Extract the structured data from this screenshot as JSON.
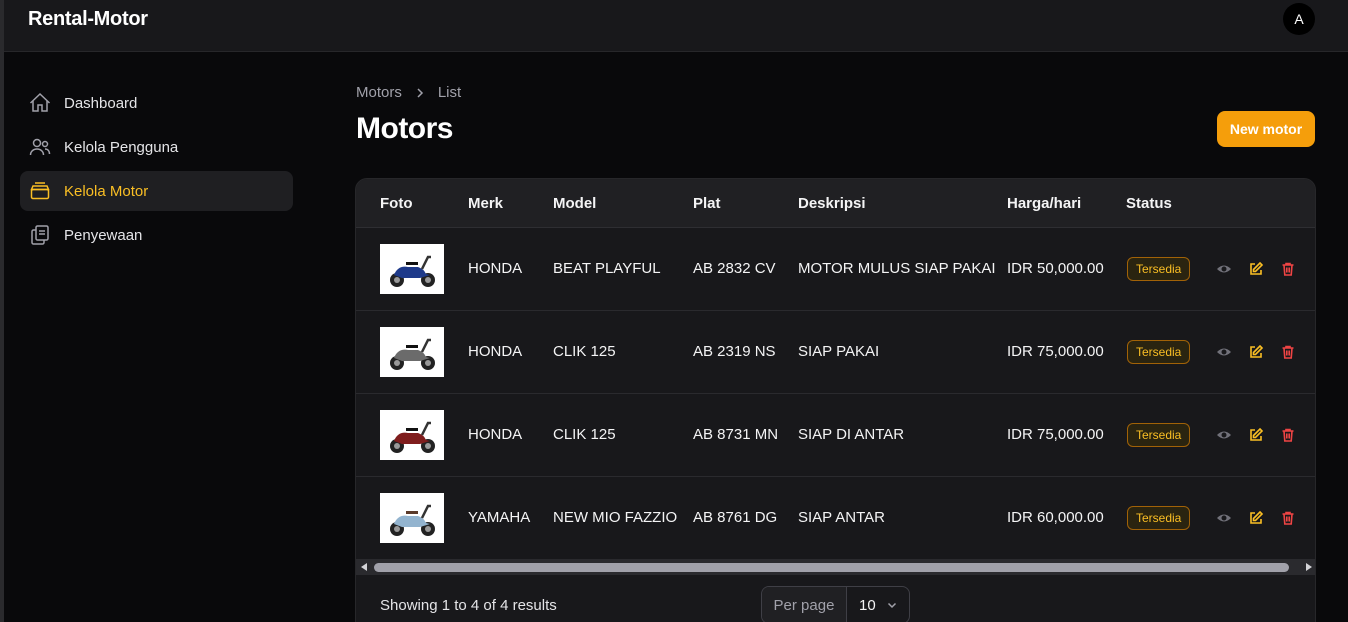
{
  "app": {
    "title": "Rental-Motor",
    "avatar_initial": "A"
  },
  "sidebar": {
    "items": [
      {
        "label": "Dashboard",
        "icon": "home-icon",
        "active": false
      },
      {
        "label": "Kelola Pengguna",
        "icon": "users-icon",
        "active": false
      },
      {
        "label": "Kelola Motor",
        "icon": "archive-box-icon",
        "active": true
      },
      {
        "label": "Penyewaan",
        "icon": "clipboard-icon",
        "active": false
      }
    ]
  },
  "breadcrumb": [
    "Motors",
    "List"
  ],
  "page": {
    "title": "Motors",
    "new_button": "New motor"
  },
  "table": {
    "columns": [
      "Foto",
      "Merk",
      "Model",
      "Plat",
      "Deskripsi",
      "Harga/hari",
      "Status"
    ],
    "rows": [
      {
        "merk": "HONDA",
        "model": "BEAT PLAYFUL",
        "plat": "AB 2832 CV",
        "deskripsi": "MOTOR MULUS SIAP PAKAI",
        "harga": "IDR 50,000.00",
        "status": "Tersedia",
        "photo_color": "#1e3a8a"
      },
      {
        "merk": "HONDA",
        "model": "CLIK 125",
        "plat": "AB 2319 NS",
        "deskripsi": "SIAP PAKAI",
        "harga": "IDR 75,000.00",
        "status": "Tersedia",
        "photo_color": "#6b6b6b"
      },
      {
        "merk": "HONDA",
        "model": "CLIK 125",
        "plat": "AB 8731 MN",
        "deskripsi": "SIAP DI ANTAR",
        "harga": "IDR 75,000.00",
        "status": "Tersedia",
        "photo_color": "#7f1d1d"
      },
      {
        "merk": "YAMAHA",
        "model": "NEW MIO FAZZIO",
        "plat": "AB 8761 DG",
        "deskripsi": "SIAP ANTAR",
        "harga": "IDR 60,000.00",
        "status": "Tersedia",
        "photo_color": "#93b4cf"
      }
    ]
  },
  "footer": {
    "showing": "Showing 1 to 4 of 4 results",
    "per_page_label": "Per page",
    "per_page_value": "10"
  },
  "colors": {
    "accent": "#f59e0b",
    "badge_text": "#fbbf24",
    "danger": "#ef4444",
    "view": "#a1a1aa"
  }
}
